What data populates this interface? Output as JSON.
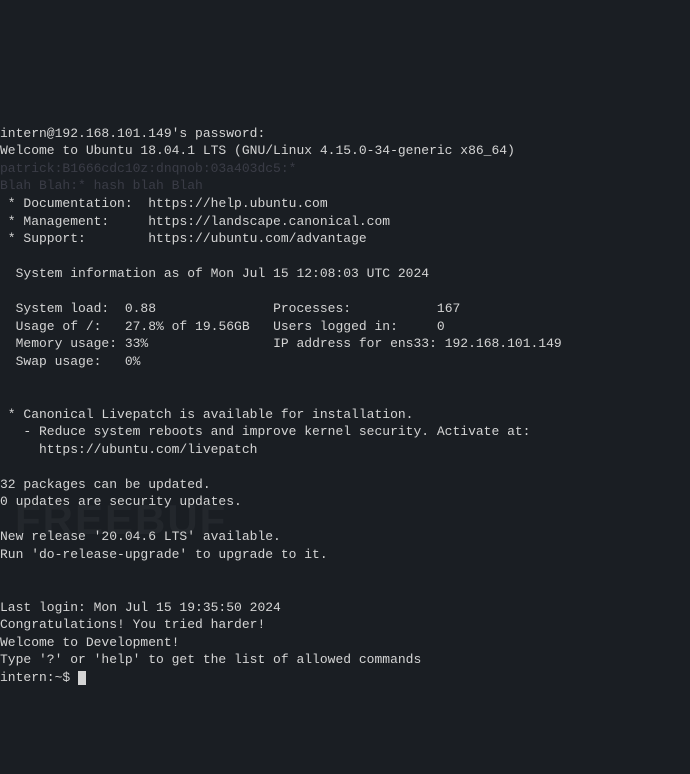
{
  "login": {
    "password_prompt": "intern@192.168.101.149's password:",
    "welcome": "Welcome to Ubuntu 18.04.1 LTS (GNU/Linux 4.15.0-34-generic x86_64)",
    "hash1": "patrick:B1666cdc10z:dnqnob:03a403dc5:*",
    "hash2": "Blah Blah:* hash blah Blah"
  },
  "links": {
    "documentation_label": " * Documentation:  ",
    "documentation_url": "https://help.ubuntu.com",
    "management_label": " * Management:     ",
    "management_url": "https://landscape.canonical.com",
    "support_label": " * Support:        ",
    "support_url": "https://ubuntu.com/advantage"
  },
  "sysinfo": {
    "header": "  System information as of Mon Jul 15 12:08:03 UTC 2024",
    "sysload_label": "  System load:  ",
    "sysload_value": "0.88",
    "processes_label": "Processes:           ",
    "processes_value": "167",
    "usage_label": "  Usage of /:   ",
    "usage_value": "27.8% of 19.56GB",
    "users_label": "Users logged in:     ",
    "users_value": "0",
    "memory_label": "  Memory usage: ",
    "memory_value": "33%",
    "ip_label": "IP address for ens33: ",
    "ip_value": "192.168.101.149",
    "swap_label": "  Swap usage:   ",
    "swap_value": "0%"
  },
  "livepatch": {
    "line1": " * Canonical Livepatch is available for installation.",
    "line2": "   - Reduce system reboots and improve kernel security. Activate at:",
    "line3": "     https://ubuntu.com/livepatch"
  },
  "updates": {
    "packages": "32 packages can be updated.",
    "security": "0 updates are security updates."
  },
  "release": {
    "available": "New release '20.04.6 LTS' available.",
    "upgrade": "Run 'do-release-upgrade' to upgrade to it."
  },
  "motd": {
    "last_login": "Last login: Mon Jul 15 19:35:50 2024",
    "congrats": "Congratulations! You tried harder!",
    "welcome_dev": "Welcome to Development!",
    "help_hint": "Type '?' or 'help' to get the list of allowed commands"
  },
  "prompt": {
    "text": "intern:~$ "
  },
  "watermark": "FREEBUF"
}
